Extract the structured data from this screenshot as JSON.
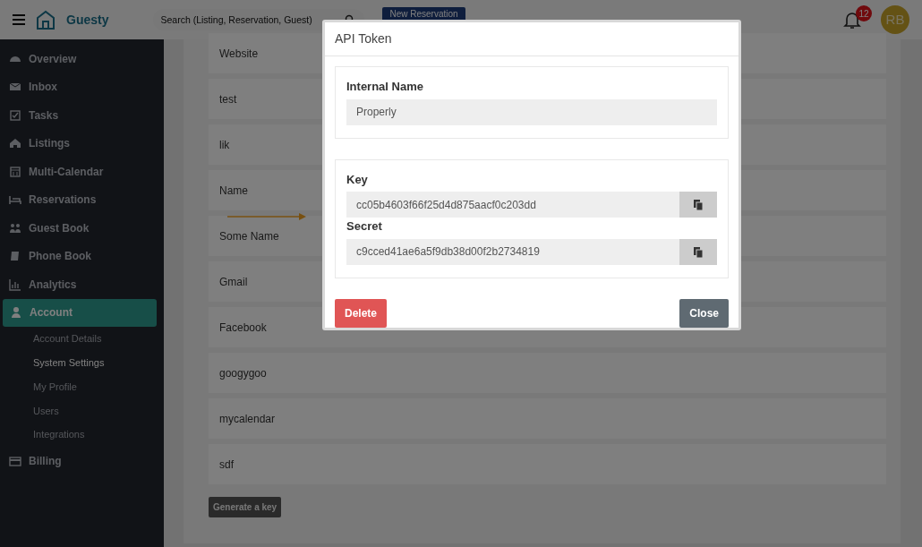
{
  "topbar": {
    "brand": "Guesty",
    "search": {
      "placeholder": "Search (Listing, Reservation, Guest)"
    },
    "new_button": "New Reservation",
    "notifications": "12",
    "avatar": "RB"
  },
  "sidebar": {
    "items": [
      {
        "label": "Overview",
        "selected": false
      },
      {
        "label": "Inbox",
        "selected": false
      },
      {
        "label": "Tasks",
        "selected": false
      },
      {
        "label": "Listings",
        "selected": false
      },
      {
        "label": "Multi-Calendar",
        "selected": false
      },
      {
        "label": "Reservations",
        "selected": false
      },
      {
        "label": "Guest Book",
        "selected": false
      },
      {
        "label": "Phone Book",
        "selected": false
      },
      {
        "label": "Analytics",
        "selected": false
      },
      {
        "label": "Account",
        "selected": true,
        "children": [
          {
            "label": "Account Details",
            "selected": false
          },
          {
            "label": "System Settings",
            "selected": true
          },
          {
            "label": "My Profile",
            "selected": false
          },
          {
            "label": "Users",
            "selected": false
          },
          {
            "label": "Integrations",
            "selected": false
          }
        ]
      },
      {
        "label": "Billing",
        "selected": false
      }
    ]
  },
  "keys": {
    "rows": [
      "Website",
      "test",
      "lik",
      "Name",
      "Some Name",
      "Gmail",
      "Facebook",
      "googygoo",
      "mycalendar",
      "sdf"
    ],
    "generate_button": "Generate a key"
  },
  "modal": {
    "title": "API Token",
    "internal_name": {
      "label": "Internal Name",
      "value": "Properly"
    },
    "key": {
      "label": "Key",
      "value": "cc05b4603f66f25d4d875aacf0c203dd"
    },
    "secret": {
      "label": "Secret",
      "value": "c9cced41ae6a5f9db38d00f2b2734819"
    },
    "delete_button": "Delete",
    "close_button": "Close"
  }
}
